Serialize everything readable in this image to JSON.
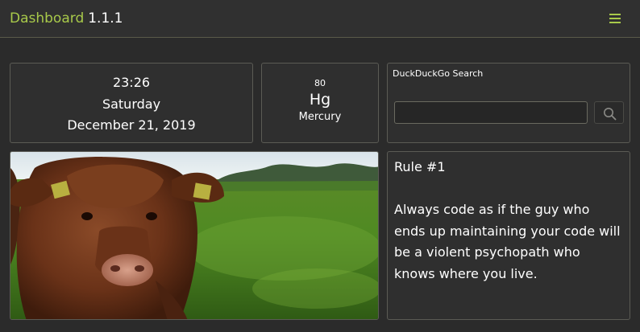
{
  "header": {
    "app_name": "Dashboard",
    "version": "1.1.1",
    "menu_icon": "hamburger-icon",
    "accent_color": "#a8c94a"
  },
  "clock": {
    "time": "23:26",
    "weekday": "Saturday",
    "date": "December 21, 2019"
  },
  "element": {
    "atomic_number": "80",
    "symbol": "Hg",
    "name": "Mercury"
  },
  "search": {
    "title": "DuckDuckGo Search",
    "value": "",
    "placeholder": "",
    "button_icon": "search-icon"
  },
  "image": {
    "subject": "highland-cow-photo"
  },
  "quote": {
    "title": "Rule #1",
    "text": "Always code as if the guy who ends up maintaining your code will be a violent psychopath who knows where you live."
  }
}
